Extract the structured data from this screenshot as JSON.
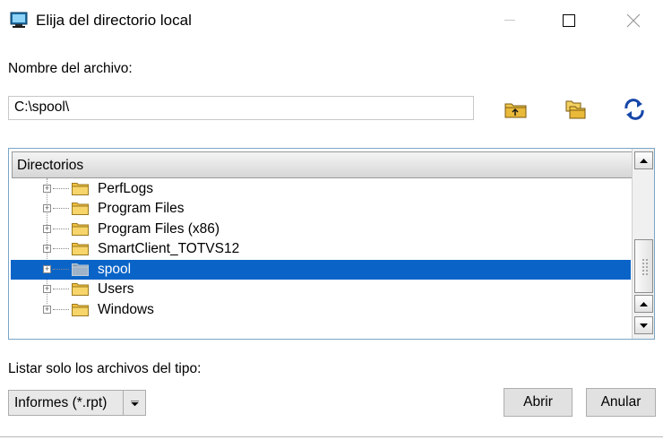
{
  "window": {
    "title": "Elija del directorio local",
    "icon": "computer-window-icon",
    "controls": [
      "minimize-icon",
      "maximize-icon",
      "close-icon"
    ]
  },
  "filename": {
    "label": "Nombre del archivo:",
    "value": "C:\\spool\\"
  },
  "toolbar": {
    "icons": [
      "folder-up-icon",
      "new-folder-icon",
      "refresh-icon"
    ]
  },
  "tree": {
    "header": "Directorios",
    "items": [
      {
        "label": "PerfLogs",
        "selected": false
      },
      {
        "label": "Program Files",
        "selected": false
      },
      {
        "label": "Program Files (x86)",
        "selected": false
      },
      {
        "label": "SmartClient_TOTVS12",
        "selected": false
      },
      {
        "label": "spool",
        "selected": true
      },
      {
        "label": "Users",
        "selected": false
      },
      {
        "label": "Windows",
        "selected": false
      }
    ]
  },
  "filetype": {
    "label": "Listar solo los archivos del tipo:",
    "selected": "Informes (*.rpt)"
  },
  "buttons": {
    "open": "Abrir",
    "cancel": "Anular"
  },
  "colors": {
    "selection": "#0a64c8",
    "panel_border": "#7aa6c7",
    "refresh_icon": "#1646a8",
    "folder": "#f0c040"
  }
}
